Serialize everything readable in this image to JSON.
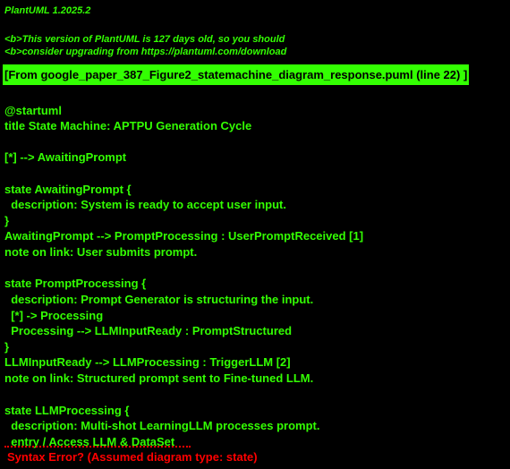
{
  "header": {
    "version": "PlantUML 1.2025.2",
    "warning_line1": "<b>This version of PlantUML is 127 days old, so you should",
    "warning_line2": "<b>consider upgrading from https://plantuml.com/download"
  },
  "file_reference": "[From google_paper_387_Figure2_statemachine_diagram_response.puml (line 22) ]",
  "source_lines": [
    "@startuml",
    "title State Machine: APTPU Generation Cycle",
    "",
    "[*] --> AwaitingPrompt",
    "",
    "state AwaitingPrompt {",
    "  description: System is ready to accept user input.",
    "}",
    "AwaitingPrompt --> PromptProcessing : UserPromptReceived [1]",
    "note on link: User submits prompt.",
    "",
    "state PromptProcessing {",
    "  description: Prompt Generator is structuring the input.",
    "  [*] -> Processing",
    "  Processing --> LLMInputReady : PromptStructured",
    "}",
    "LLMInputReady --> LLMProcessing : TriggerLLM [2]",
    "note on link: Structured prompt sent to Fine-tuned LLM.",
    "",
    "state LLMProcessing {",
    "  description: Multi-shot LearningLLM processes prompt.",
    "  entry / Access LLM & DataSet"
  ],
  "error_message": "Syntax Error? (Assumed diagram type: state)",
  "colors": {
    "background": "#000000",
    "text": "#33FF02",
    "error": "#FF0000"
  }
}
